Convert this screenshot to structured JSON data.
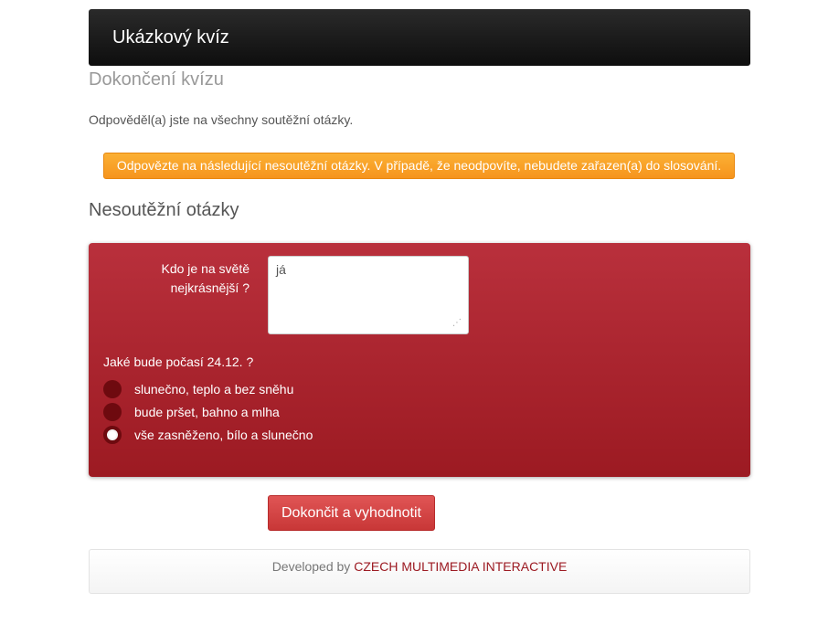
{
  "navbar": {
    "brand": "Ukázkový kvíz"
  },
  "page": {
    "title": "Dokončení kvízu",
    "intro": "Odpověděl(a) jste na všechny soutěžní otázky.",
    "alert": "Odpovězte na následující nesoutěžní otázky. V případě, že neodpovíte, nebudete zařazen(a) do slosování."
  },
  "section": {
    "title": "Nesoutěžní otázky"
  },
  "question1": {
    "label_line1": "Kdo je na světě",
    "label_line2": "nejkrásnější ?",
    "value": "já"
  },
  "question2": {
    "label": "Jaké bude počasí 24.12. ?",
    "options": [
      {
        "label": "slunečno, teplo a bez sněhu",
        "checked": false
      },
      {
        "label": "bude pršet, bahno a mlha",
        "checked": false
      },
      {
        "label": "vše zasněženo, bílo a slunečno",
        "checked": true
      }
    ]
  },
  "submit": {
    "label": "Dokončit a vyhodnotit"
  },
  "footer": {
    "prefix": "Developed by",
    "link": "CZECH MULTIMEDIA INTERACTIVE"
  },
  "colors": {
    "panel": "#b02a34",
    "alert": "#f8a22a",
    "button": "#d94545",
    "link": "#9c1a22"
  }
}
